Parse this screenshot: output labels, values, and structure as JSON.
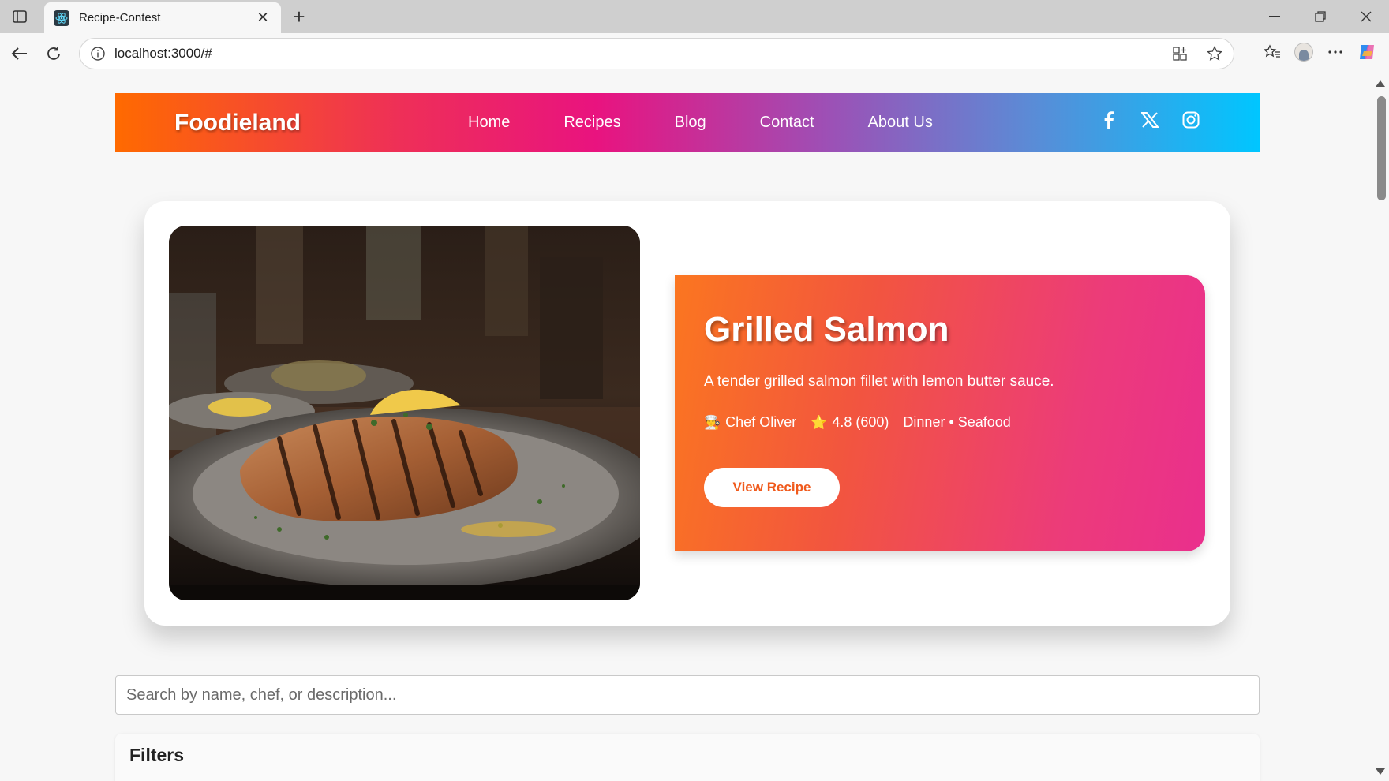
{
  "browser": {
    "tab_title": "Recipe-Contest",
    "url": "localhost:3000/#"
  },
  "site": {
    "logo": "Foodieland",
    "nav": [
      "Home",
      "Recipes",
      "Blog",
      "Contact",
      "About Us"
    ],
    "social": [
      "facebook-icon",
      "x-icon",
      "instagram-icon"
    ]
  },
  "hero": {
    "title": "Grilled Salmon",
    "description": "A tender grilled salmon fillet with lemon butter sauce.",
    "chef_emoji": "👨‍🍳",
    "chef": "Chef Oliver",
    "rating_emoji": "⭐",
    "rating": "4.8 (600)",
    "tags": "Dinner • Seafood",
    "button": "View Recipe",
    "image_alt": "Grilled salmon on a plate in a restaurant"
  },
  "search": {
    "placeholder": "Search by name, chef, or description..."
  },
  "filters": {
    "title": "Filters"
  },
  "colors": {
    "accent_orange": "#ff6a00",
    "accent_pink": "#e9137f",
    "accent_cyan": "#00c6ff"
  }
}
